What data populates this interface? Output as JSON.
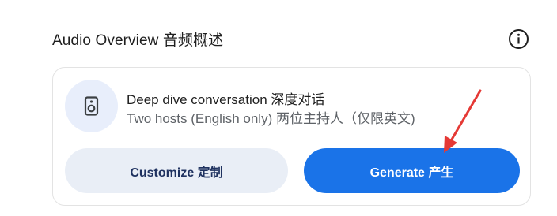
{
  "header": {
    "title": "Audio Overview  音频概述",
    "info_icon": "info-icon"
  },
  "card": {
    "icon": "speaker-icon",
    "title": "Deep dive conversation 深度对话",
    "subtitle": "Two hosts (English only)  两位主持人（仅限英文)"
  },
  "buttons": {
    "customize_label": "Customize 定制",
    "generate_label": "Generate 产生"
  },
  "annotation": {
    "arrow_color": "#e53935"
  },
  "colors": {
    "primary": "#1a73e8",
    "secondary_button": "#e9eef6",
    "icon_bg": "#e8eefb"
  }
}
